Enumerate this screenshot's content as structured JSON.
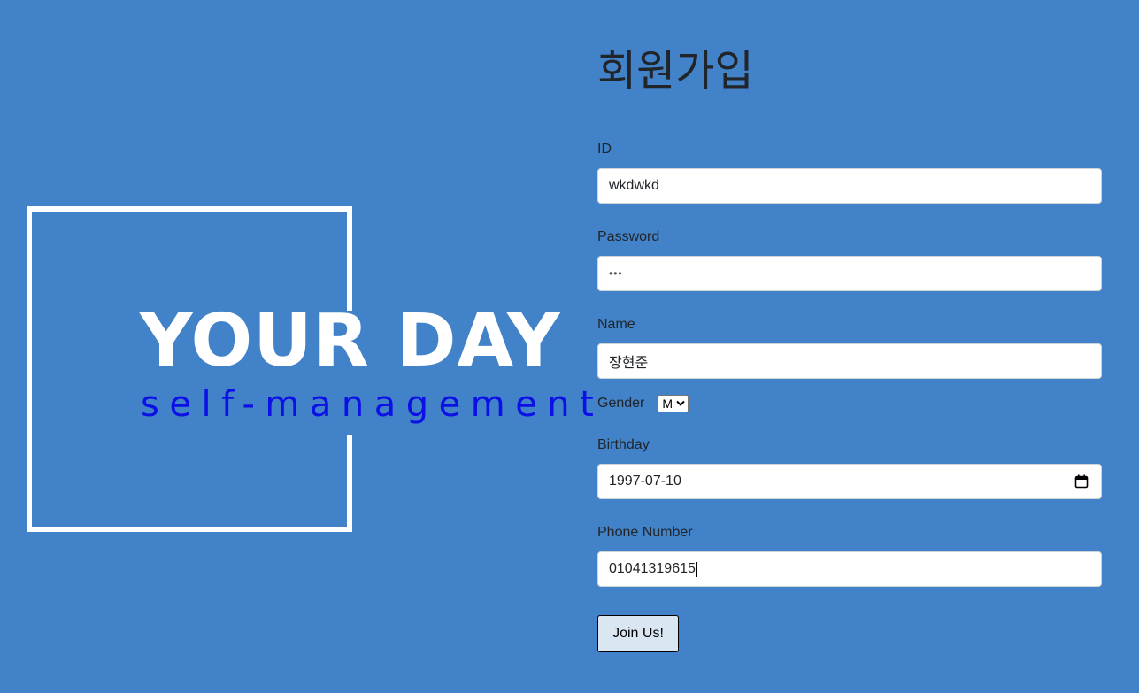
{
  "logo": {
    "title": "YOUR DAY",
    "subtitle": "self-management",
    "title_color": "#ffffff",
    "subtitle_color": "#0c0fe6"
  },
  "form": {
    "title": "회원가입",
    "fields": {
      "id": {
        "label": "ID",
        "value": "wkdwkd"
      },
      "password": {
        "label": "Password",
        "value": "•••"
      },
      "name": {
        "label": "Name",
        "value": "장현준"
      },
      "gender": {
        "label": "Gender",
        "selected": "M"
      },
      "birthday": {
        "label": "Birthday",
        "value": "1997-07-10",
        "icon": "calendar-icon"
      },
      "phone": {
        "label": "Phone Number",
        "value": "01041319615"
      }
    },
    "submit_label": "Join Us!"
  },
  "colors": {
    "background": "#4182c8",
    "button_bg": "#dbe6f3"
  }
}
